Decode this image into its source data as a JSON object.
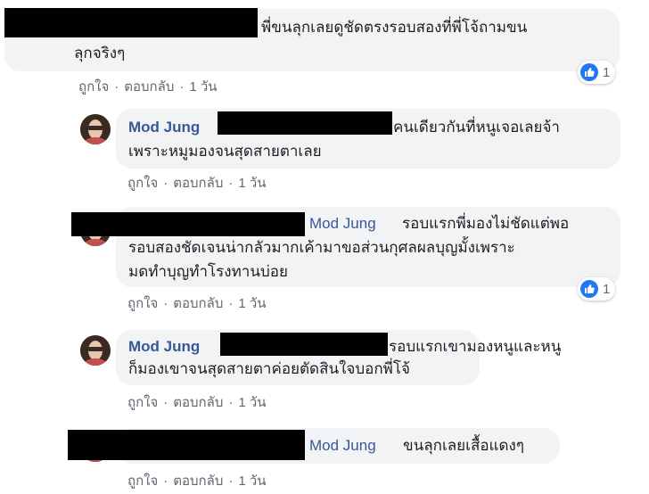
{
  "actions": {
    "like": "ถูกใจ",
    "reply": "ตอบกลับ",
    "time": "1 วัน",
    "dot": "·"
  },
  "comments": [
    {
      "text_line1": "พี่ขนลุกเลยดูชัดตรงรอบสองที่พี่โจ้ถามขน",
      "text_line2": "ลุกจริงๆ",
      "reaction_count": "1"
    },
    {
      "author": "Mod Jung",
      "text_line1": "คนเดียวกันที่หนูเจอเลยจ้า",
      "text_line2": "เพราะหมูมองจนสุดสายตาเลย"
    },
    {
      "mention": "Mod Jung",
      "text_line1": "รอบแรกพี่มองไม่ชัดแต่พอ",
      "text_line2": "รอบสองชัดเจนน่ากลัวมากเค้ามาขอส่วนกุศลผลบุญมั้งเพราะ",
      "text_line3": "มดทำบุญทำโรงทานบ่อย",
      "reaction_count": "1"
    },
    {
      "author": "Mod Jung",
      "text_line1": "รอบแรกเขามองหนูและหนู",
      "text_line2": "ก็มองเขาจนสุดสายตาค่อยตัดสินใจบอกพี่โจ้"
    },
    {
      "mention": "Mod Jung",
      "text_line1": "ขนลุกเลยเสื้อแดงๆ"
    }
  ],
  "colors": {
    "bubble": "#f2f3f5",
    "name": "#385898",
    "like": "#2078f4",
    "meta": "#606770"
  }
}
